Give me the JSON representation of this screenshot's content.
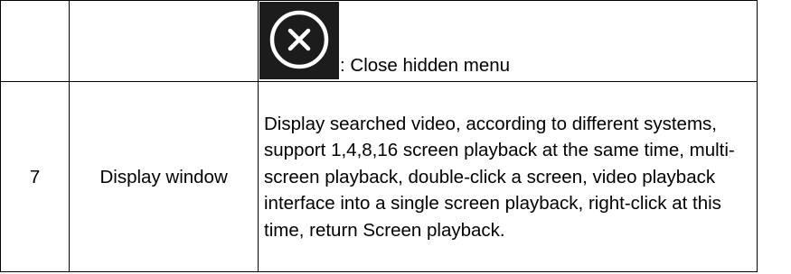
{
  "rows": [
    {
      "number": "",
      "name": "",
      "icon": "close-circle-icon",
      "description": ": Close hidden menu"
    },
    {
      "number": "7",
      "name": "Display window",
      "description": "Display searched video, according to different systems, support 1,4,8,16 screen playback at the same time, multi-screen playback, double-click a screen, video playback interface into a single screen playback, right-click at this time, return Screen playback."
    }
  ],
  "colors": {
    "border": "#000000",
    "icon_background": "#1c1c1c",
    "icon_stroke": "#ffffff"
  }
}
